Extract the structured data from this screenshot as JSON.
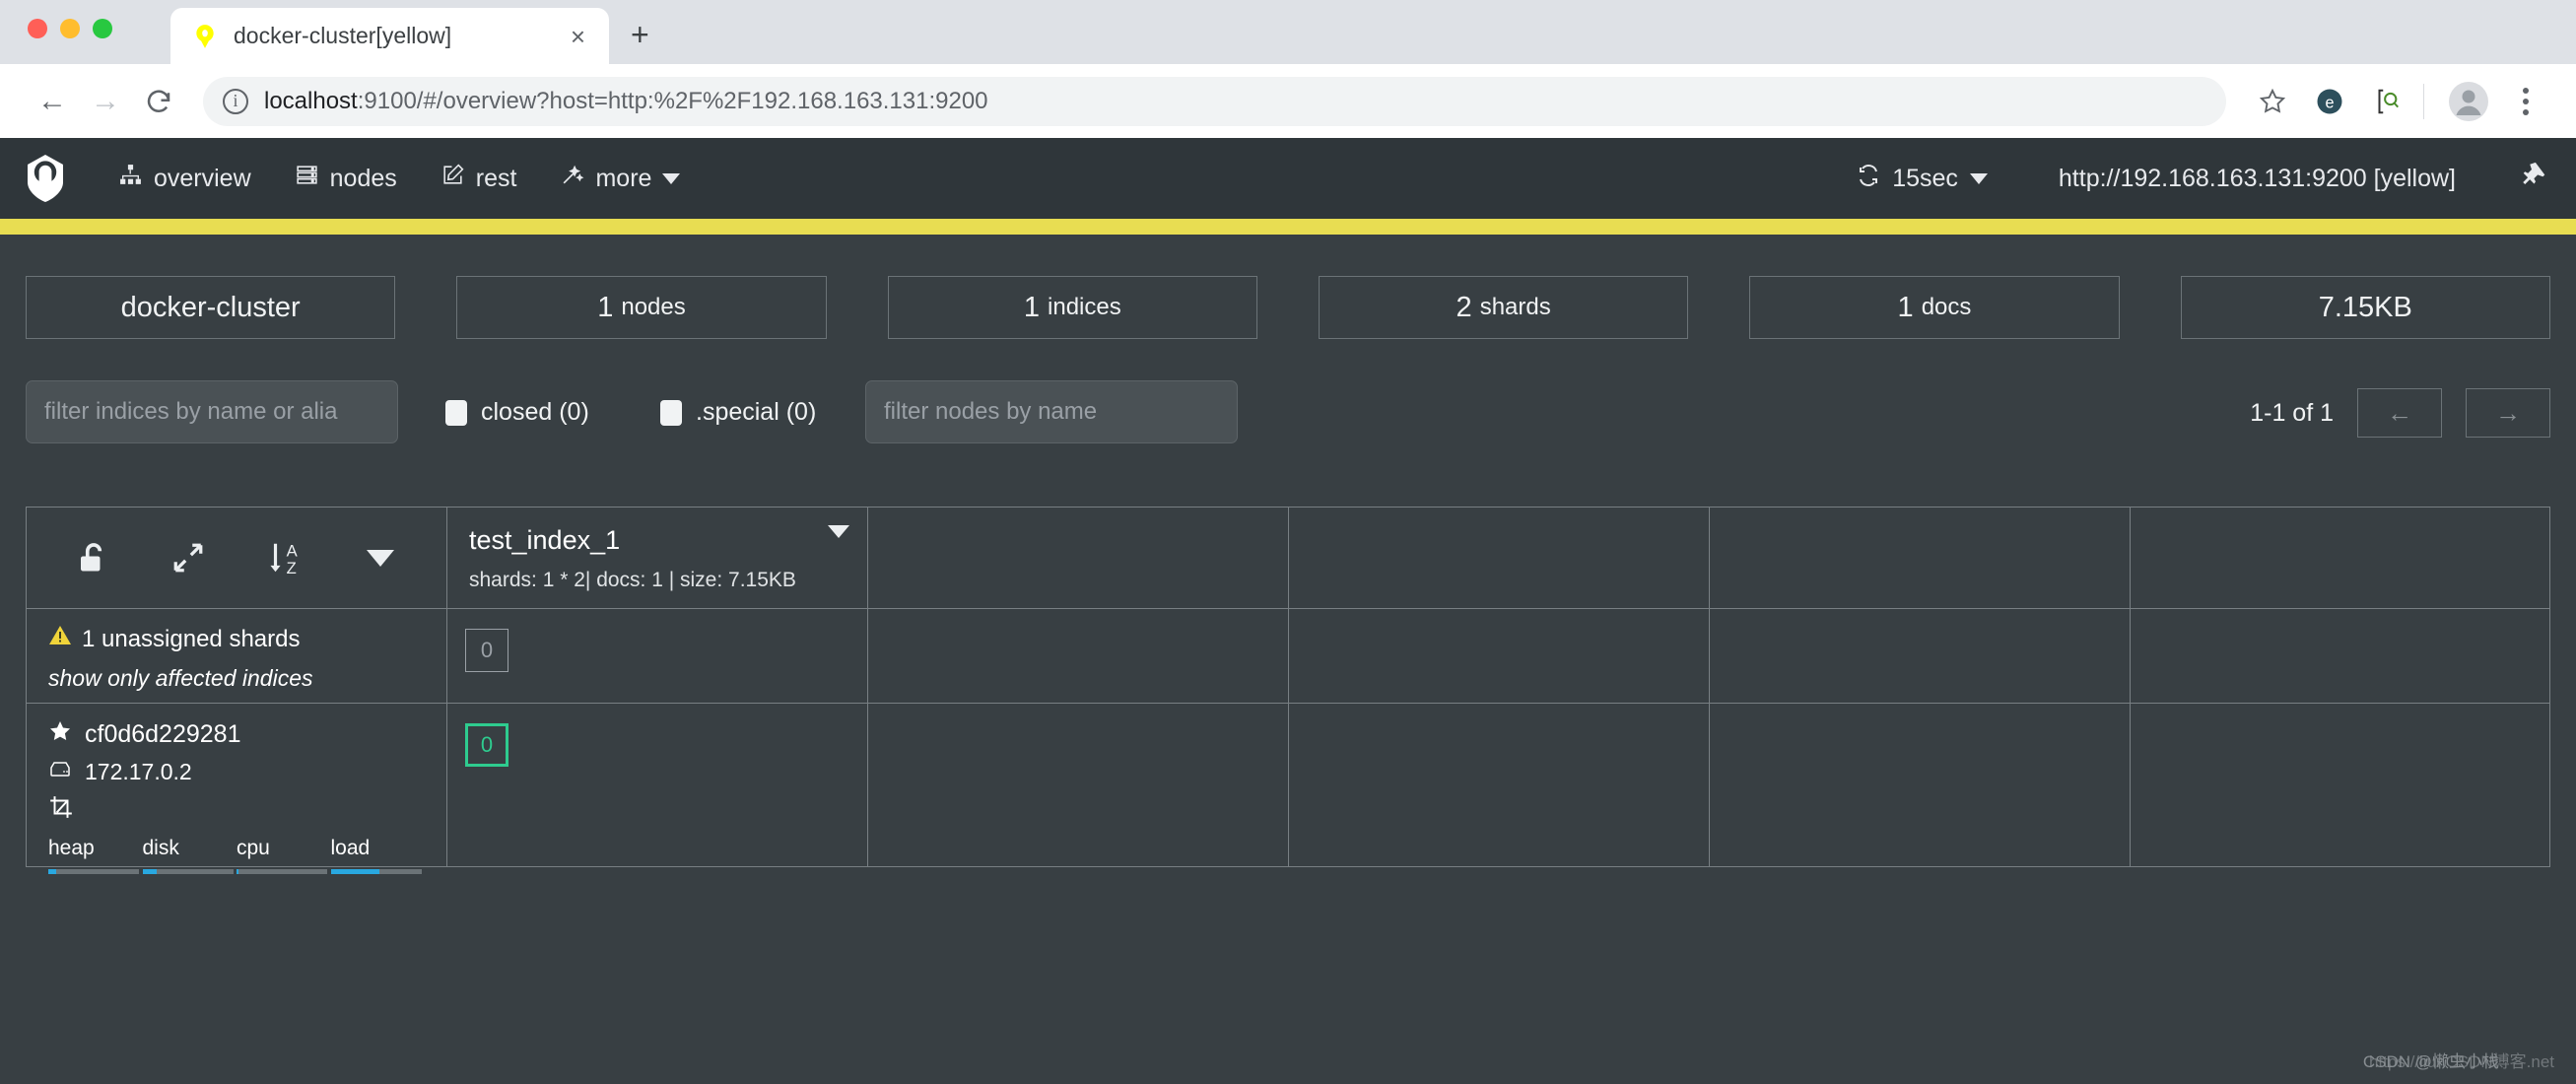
{
  "browser": {
    "tab": {
      "title": "docker-cluster[yellow]",
      "favicon": "elasticsearch-head-icon",
      "close": "×"
    },
    "newtab_label": "+",
    "back": "←",
    "forward": "→",
    "reload": "⟳",
    "omnibox": {
      "info_glyph": "i",
      "host": "localhost",
      "path": ":9100/#/overview?host=http:%2F%2F192.168.163.131:9200",
      "full_url": "localhost:9100/#/overview?host=http:%2F%2F192.168.163.131:9200"
    },
    "icons": {
      "bookmark": "star-icon",
      "extension1": "ecosia-extension-icon",
      "extension2": "json-viewer-extension-icon",
      "profile": "avatar-icon",
      "menu": "kebab-menu-icon"
    }
  },
  "app": {
    "nav": [
      {
        "label": "overview",
        "icon": "sitemap-icon"
      },
      {
        "label": "nodes",
        "icon": "server-icon"
      },
      {
        "label": "rest",
        "icon": "edit-square-icon"
      },
      {
        "label": "more",
        "icon": "magic-wand-icon",
        "caret": true
      }
    ],
    "refresh": {
      "label": "15sec",
      "icon": "refresh-icon"
    },
    "cluster_url": "http://192.168.163.131:9200 [yellow]",
    "connect_icon": "plug-icon",
    "health_color": "#e8dd52"
  },
  "stats": [
    {
      "value": "docker-cluster",
      "unit": ""
    },
    {
      "value": "1",
      "unit": "nodes"
    },
    {
      "value": "1",
      "unit": "indices"
    },
    {
      "value": "2",
      "unit": "shards"
    },
    {
      "value": "1",
      "unit": "docs"
    },
    {
      "value": "7.15KB",
      "unit": ""
    }
  ],
  "filters": {
    "indices_placeholder": "filter indices by name or alia",
    "indices_value": "",
    "closed_label": "closed (0)",
    "special_label": ".special (0)",
    "nodes_placeholder": "filter nodes by name",
    "nodes_value": "",
    "pager_text": "1-1 of 1",
    "prev": "←",
    "next": "→"
  },
  "table": {
    "tools": [
      {
        "name": "unlock-icon"
      },
      {
        "name": "expand-icon"
      },
      {
        "name": "sort-az-icon"
      },
      {
        "name": "caret-down-icon"
      }
    ],
    "index": {
      "name": "test_index_1",
      "meta": "shards: 1 * 2| docs: 1 | size: 7.15KB"
    },
    "unassigned": {
      "warning_icon": "warning-triangle-icon",
      "title": "1 unassigned shards",
      "link": "show only affected indices",
      "shard": "0"
    },
    "node": {
      "master_icon": "star-icon",
      "name": "cf0d6d229281",
      "host_icon": "server-box-icon",
      "ip": "172.17.0.2",
      "action_icon": "crop-icon",
      "shard": "0",
      "gauges": [
        {
          "label": "heap",
          "percent": 9
        },
        {
          "label": "disk",
          "percent": 16
        },
        {
          "label": "cpu",
          "percent": 2
        },
        {
          "label": "load",
          "percent": 54
        }
      ]
    },
    "empty_columns": 4
  },
  "watermark": {
    "line1": "https://liunCSDN博客.net",
    "line2": "CSDN @懒虫小栈"
  }
}
